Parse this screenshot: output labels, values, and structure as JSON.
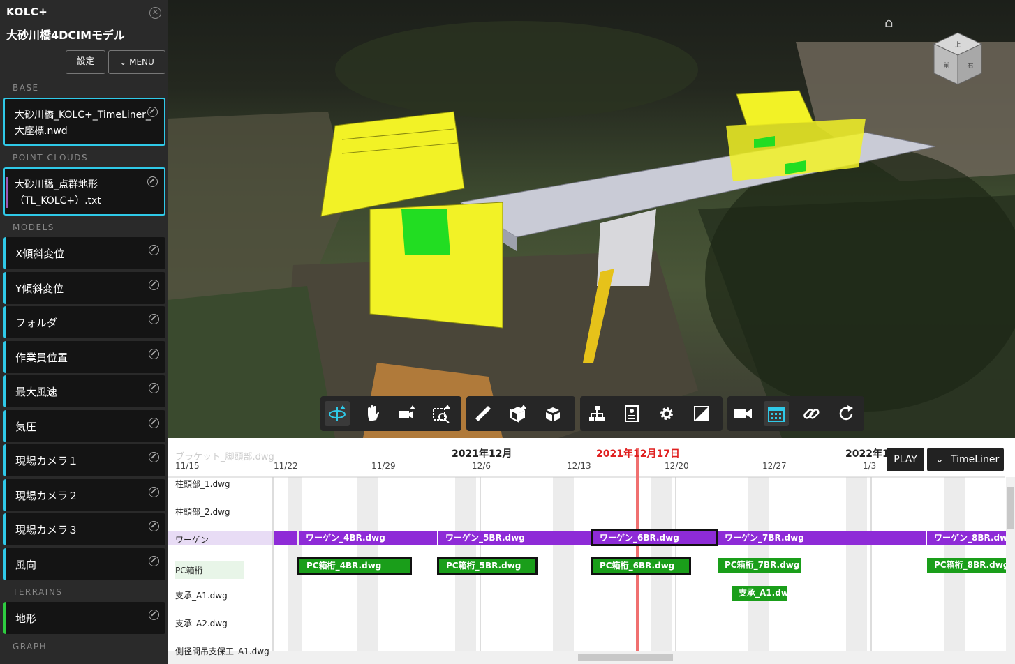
{
  "sidebar": {
    "brand": "KOLC+",
    "project": "大砂川橋4DCIMモデル",
    "settings_label": "設定",
    "menu_label": "MENU",
    "sections": {
      "base": "BASE",
      "point_clouds": "POINT CLOUDS",
      "models": "MODELS",
      "terrains": "TERRAINS",
      "graph": "GRAPH"
    },
    "base_item": "大砂川橋_KOLC+_TimeLiner_大座標.nwd",
    "pointcloud_item": "大砂川橋_点群地形（TL_KOLC+）.txt",
    "models": [
      "X傾斜変位",
      "Y傾斜変位",
      "フォルダ",
      "作業員位置",
      "最大風速",
      "気圧",
      "現場カメラ１",
      "現場カメラ２",
      "現場カメラ３",
      "風向"
    ],
    "terrain_item": "地形"
  },
  "viewport": {
    "navcube_top": "上",
    "navcube_front": "前",
    "navcube_right": "右"
  },
  "timeline": {
    "months": [
      "2021年12月",
      "2021年12月17日",
      "2022年1"
    ],
    "ghost_label": "ブラケット_脚頭部.dwg",
    "ticks": [
      "11/15",
      "11/22",
      "11/29",
      "12/6",
      "12/13",
      "12/20",
      "12/27",
      "1/3"
    ],
    "play_label": "PLAY",
    "timeliner_label": "TimeLiner",
    "rows": [
      "柱頭部_1.dwg",
      "柱頭部_2.dwg",
      "ワーゲン",
      "PC箱桁",
      "支承_A1.dwg",
      "支承_A2.dwg",
      "側径間吊支保工_A1.dwg"
    ],
    "wagen_bars": [
      "ワーゲン_4BR.dwg",
      "ワーゲン_5BR.dwg",
      "ワーゲン_6BR.dwg",
      "ワーゲン_7BR.dwg",
      "ワーゲン_8BR.dwg"
    ],
    "pc_bars": [
      "PC箱桁_4BR.dwg",
      "PC箱桁_5BR.dwg",
      "PC箱桁_6BR.dwg",
      "PC箱桁_7BR.dwg",
      "PC箱桁_8BR.dwg"
    ],
    "shisho_bar": "支承_A1.dw"
  },
  "colors": {
    "accent": "#2fc9e8",
    "wagen": "#8e2bd7",
    "pc_box": "#1a9e1a",
    "current_date": "#e02020"
  }
}
